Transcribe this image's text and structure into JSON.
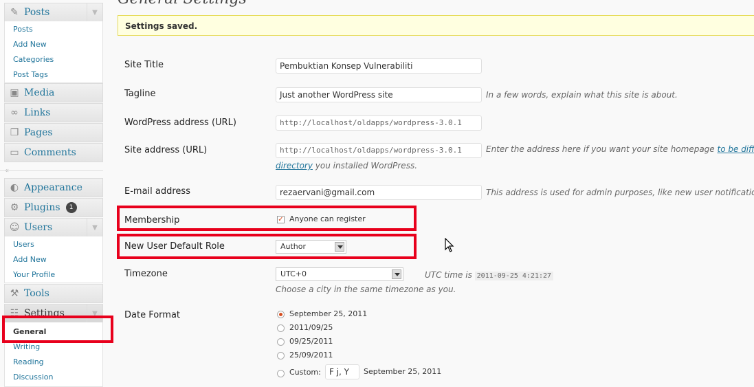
{
  "sidebar": {
    "posts": {
      "label": "Posts",
      "items": [
        "Posts",
        "Add New",
        "Categories",
        "Post Tags"
      ]
    },
    "media": "Media",
    "links": "Links",
    "pages": "Pages",
    "comments": "Comments",
    "appearance": "Appearance",
    "plugins": {
      "label": "Plugins",
      "badge": "1"
    },
    "users": {
      "label": "Users",
      "items": [
        "Users",
        "Add New",
        "Your Profile"
      ]
    },
    "tools": "Tools",
    "settings": {
      "label": "Settings",
      "items": [
        "General",
        "Writing",
        "Reading",
        "Discussion"
      ]
    }
  },
  "page": {
    "title": "General Settings",
    "notice": "Settings saved."
  },
  "form": {
    "site_title": {
      "label": "Site Title",
      "value": "Pembuktian Konsep Vulnerabiliti"
    },
    "tagline": {
      "label": "Tagline",
      "value": "Just another WordPress site",
      "desc": "In a few words, explain what this site is about."
    },
    "wp_address": {
      "label": "WordPress address (URL)",
      "value": "http://localhost/oldapps/wordpress-3.0.1"
    },
    "site_address": {
      "label": "Site address (URL)",
      "value": "http://localhost/oldapps/wordpress-3.0.1",
      "desc_before": "Enter the address here if you want your site homepage",
      "desc_link": "to be diffe",
      "desc_link2": "directory",
      "desc_after": "you installed WordPress."
    },
    "email": {
      "label": "E-mail address",
      "value": "rezaervani@gmail.com",
      "desc": "This address is used for admin purposes, like new user notificatio"
    },
    "membership": {
      "label": "Membership",
      "checkbox_label": "Anyone can register",
      "checked": true
    },
    "default_role": {
      "label": "New User Default Role",
      "value": "Author"
    },
    "timezone": {
      "label": "Timezone",
      "value": "UTC+0",
      "utc_prefix": "UTC time is",
      "utc_value": "2011-09-25 4:21:27",
      "desc": "Choose a city in the same timezone as you."
    },
    "date_format": {
      "label": "Date Format",
      "options": [
        "September 25, 2011",
        "2011/09/25",
        "09/25/2011",
        "25/09/2011"
      ],
      "custom_label": "Custom:",
      "custom_value": "F j, Y",
      "custom_preview": "September 25, 2011"
    }
  },
  "colors": {
    "highlight": "#e8001c",
    "link": "#21759b",
    "notice_bg": "#ffffe0"
  }
}
